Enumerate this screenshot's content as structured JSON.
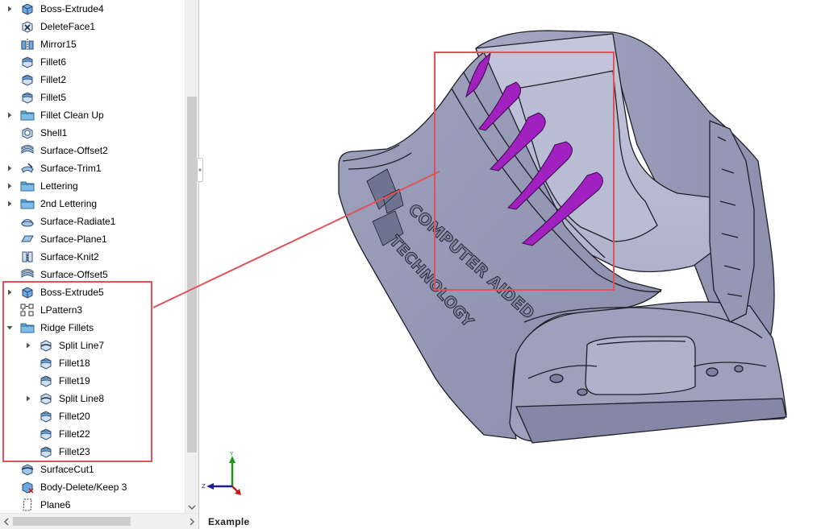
{
  "tree": {
    "items": [
      {
        "label": "Boss-Extrude4",
        "icon": "extrude-icon",
        "expandable": true,
        "indent": 0
      },
      {
        "label": "DeleteFace1",
        "icon": "delete-face-icon",
        "expandable": false,
        "indent": 0
      },
      {
        "label": "Mirror15",
        "icon": "mirror-icon",
        "expandable": false,
        "indent": 0
      },
      {
        "label": "Fillet6",
        "icon": "fillet-icon",
        "expandable": false,
        "indent": 0
      },
      {
        "label": "Fillet2",
        "icon": "fillet-icon",
        "expandable": false,
        "indent": 0
      },
      {
        "label": "Fillet5",
        "icon": "fillet-icon",
        "expandable": false,
        "indent": 0
      },
      {
        "label": "Fillet Clean Up",
        "icon": "folder-icon",
        "expandable": true,
        "indent": 0
      },
      {
        "label": "Shell1",
        "icon": "shell-icon",
        "expandable": false,
        "indent": 0
      },
      {
        "label": "Surface-Offset2",
        "icon": "surface-offset-icon",
        "expandable": false,
        "indent": 0
      },
      {
        "label": "Surface-Trim1",
        "icon": "surface-trim-icon",
        "expandable": true,
        "indent": 0
      },
      {
        "label": "Lettering",
        "icon": "folder-icon",
        "expandable": true,
        "indent": 0
      },
      {
        "label": "2nd Lettering",
        "icon": "folder-icon",
        "expandable": true,
        "indent": 0
      },
      {
        "label": "Surface-Radiate1",
        "icon": "surface-radiate-icon",
        "expandable": false,
        "indent": 0
      },
      {
        "label": "Surface-Plane1",
        "icon": "surface-plane-icon",
        "expandable": false,
        "indent": 0
      },
      {
        "label": "Surface-Knit2",
        "icon": "surface-knit-icon",
        "expandable": false,
        "indent": 0
      },
      {
        "label": "Surface-Offset5",
        "icon": "surface-offset-icon",
        "expandable": false,
        "indent": 0
      },
      {
        "label": "Boss-Extrude5",
        "icon": "extrude-icon",
        "expandable": true,
        "indent": 0
      },
      {
        "label": "LPattern3",
        "icon": "linear-pattern-icon",
        "expandable": false,
        "indent": 0
      },
      {
        "label": "Ridge Fillets",
        "icon": "folder-icon",
        "expandable": true,
        "expanded": true,
        "indent": 0
      },
      {
        "label": "Split Line7",
        "icon": "split-line-icon",
        "expandable": true,
        "indent": 1
      },
      {
        "label": "Fillet18",
        "icon": "fillet-icon",
        "expandable": false,
        "indent": 1
      },
      {
        "label": "Fillet19",
        "icon": "fillet-icon",
        "expandable": false,
        "indent": 1
      },
      {
        "label": "Split Line8",
        "icon": "split-line-icon",
        "expandable": true,
        "indent": 1
      },
      {
        "label": "Fillet20",
        "icon": "fillet-icon",
        "expandable": false,
        "indent": 1
      },
      {
        "label": "Fillet22",
        "icon": "fillet-icon",
        "expandable": false,
        "indent": 1
      },
      {
        "label": "Fillet23",
        "icon": "fillet-icon",
        "expandable": false,
        "indent": 1
      },
      {
        "label": "SurfaceCut1",
        "icon": "surface-cut-icon",
        "expandable": false,
        "indent": 0
      },
      {
        "label": "Body-Delete/Keep 3",
        "icon": "body-delete-icon",
        "expandable": false,
        "indent": 0
      },
      {
        "label": "Plane6",
        "icon": "plane-icon",
        "expandable": false,
        "indent": 0
      }
    ]
  },
  "model": {
    "embossed_text_1": "COMPUTER AIDED",
    "embossed_text_2": "TECHNOLOGY",
    "highlight_color": "#e05257",
    "ridge_color": "#a020c0",
    "body_color": "#a9adc6"
  },
  "triad": {
    "y_label": "Y",
    "z_label": "Z"
  },
  "caption": "Example"
}
